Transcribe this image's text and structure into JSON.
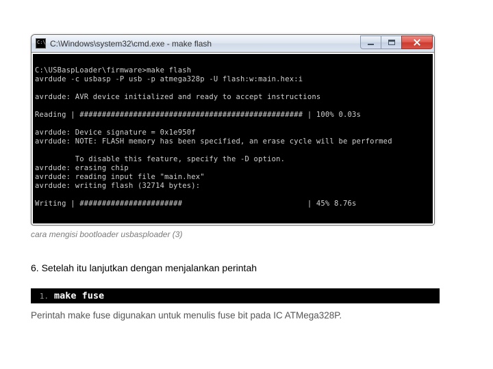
{
  "window": {
    "title": "C:\\Windows\\system32\\cmd.exe - make  flash"
  },
  "terminal": {
    "lines": [
      "C:\\USBaspLoader\\firmware>make flash",
      "avrdude -c usbasp -P usb -p atmega328p -U flash:w:main.hex:i",
      "",
      "avrdude: AVR device initialized and ready to accept instructions",
      "",
      "Reading | ################################################## | 100% 0.03s",
      "",
      "avrdude: Device signature = 0x1e950f",
      "avrdude: NOTE: FLASH memory has been specified, an erase cycle will be performed",
      "",
      "         To disable this feature, specify the -D option.",
      "avrdude: erasing chip",
      "avrdude: reading input file \"main.hex\"",
      "avrdude: writing flash (32714 bytes):",
      "",
      "Writing | #######################                            | 45% 8.76s"
    ]
  },
  "caption": "cara mengisi bootloader usbasploader (3)",
  "instruction": "6. Setelah itu lanjutkan dengan menjalankan perintah",
  "code": {
    "num": "1.",
    "cmd": "make fuse"
  },
  "explain": "Perintah make fuse digunakan untuk menulis fuse bit pada IC ATMega328P."
}
